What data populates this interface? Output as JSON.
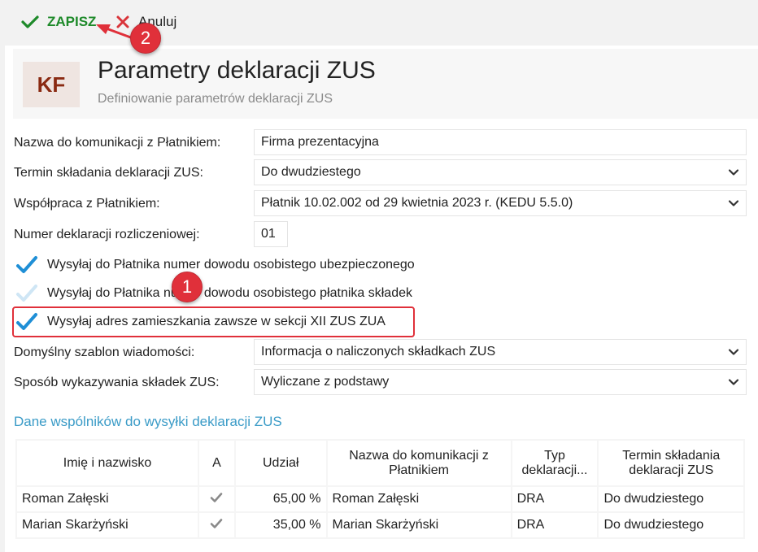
{
  "toolbar": {
    "save_label": "ZAPISZ",
    "cancel_label": "Anuluj"
  },
  "header": {
    "logo": "KF",
    "title": "Parametry deklaracji ZUS",
    "subtitle": "Definiowanie parametrów deklaracji ZUS"
  },
  "form": {
    "name_label": "Nazwa do komunikacji z Płatnikiem:",
    "name_value": "Firma prezentacyjna",
    "deadline_label": "Termin składania deklaracji ZUS:",
    "deadline_value": "Do dwudziestego",
    "cooperation_label": "Współpraca z Płatnikiem:",
    "cooperation_value": "Płatnik 10.02.002 od 29 kwietnia 2023 r. (KEDU 5.5.0)",
    "number_label": "Numer deklaracji rozliczeniowej:",
    "number_value": "01",
    "checkboxes": [
      {
        "label": "Wysyłaj do Płatnika numer dowodu osobistego ubezpieczonego",
        "checked": true
      },
      {
        "label": "Wysyłaj do Płatnika numer dowodu osobistego płatnika składek",
        "checked": false
      },
      {
        "label": "Wysyłaj adres zamieszkania zawsze w sekcji XII ZUS ZUA",
        "checked": true
      }
    ],
    "template_label": "Domyślny szablon wiadomości:",
    "template_value": "Informacja o naliczonych składkach ZUS",
    "method_label": "Sposób wykazywania składek ZUS:",
    "method_value": "Wyliczane z podstawy"
  },
  "partners": {
    "section_title": "Dane wspólników do wysyłki deklaracji ZUS",
    "columns": [
      "Imię i nazwisko",
      "A",
      "Udział",
      "Nazwa do komunikacji z Płatnikiem",
      "Typ deklaracji...",
      "Termin składania deklaracji ZUS"
    ],
    "rows": [
      {
        "name": "Roman Załęski",
        "share": "65,00 %",
        "comm_name": "Roman Załęski",
        "type": "DRA",
        "deadline": "Do dwudziestego"
      },
      {
        "name": "Marian Skarżyński",
        "share": "35,00 %",
        "comm_name": "Marian Skarżyński",
        "type": "DRA",
        "deadline": "Do dwudziestego"
      }
    ]
  },
  "annotations": {
    "badge1": "1",
    "badge2": "2"
  },
  "colors": {
    "accent": "#3a9bc7",
    "save_green": "#1e8a2a",
    "highlight_red": "#e0303a",
    "logo_text": "#8a2a12"
  }
}
